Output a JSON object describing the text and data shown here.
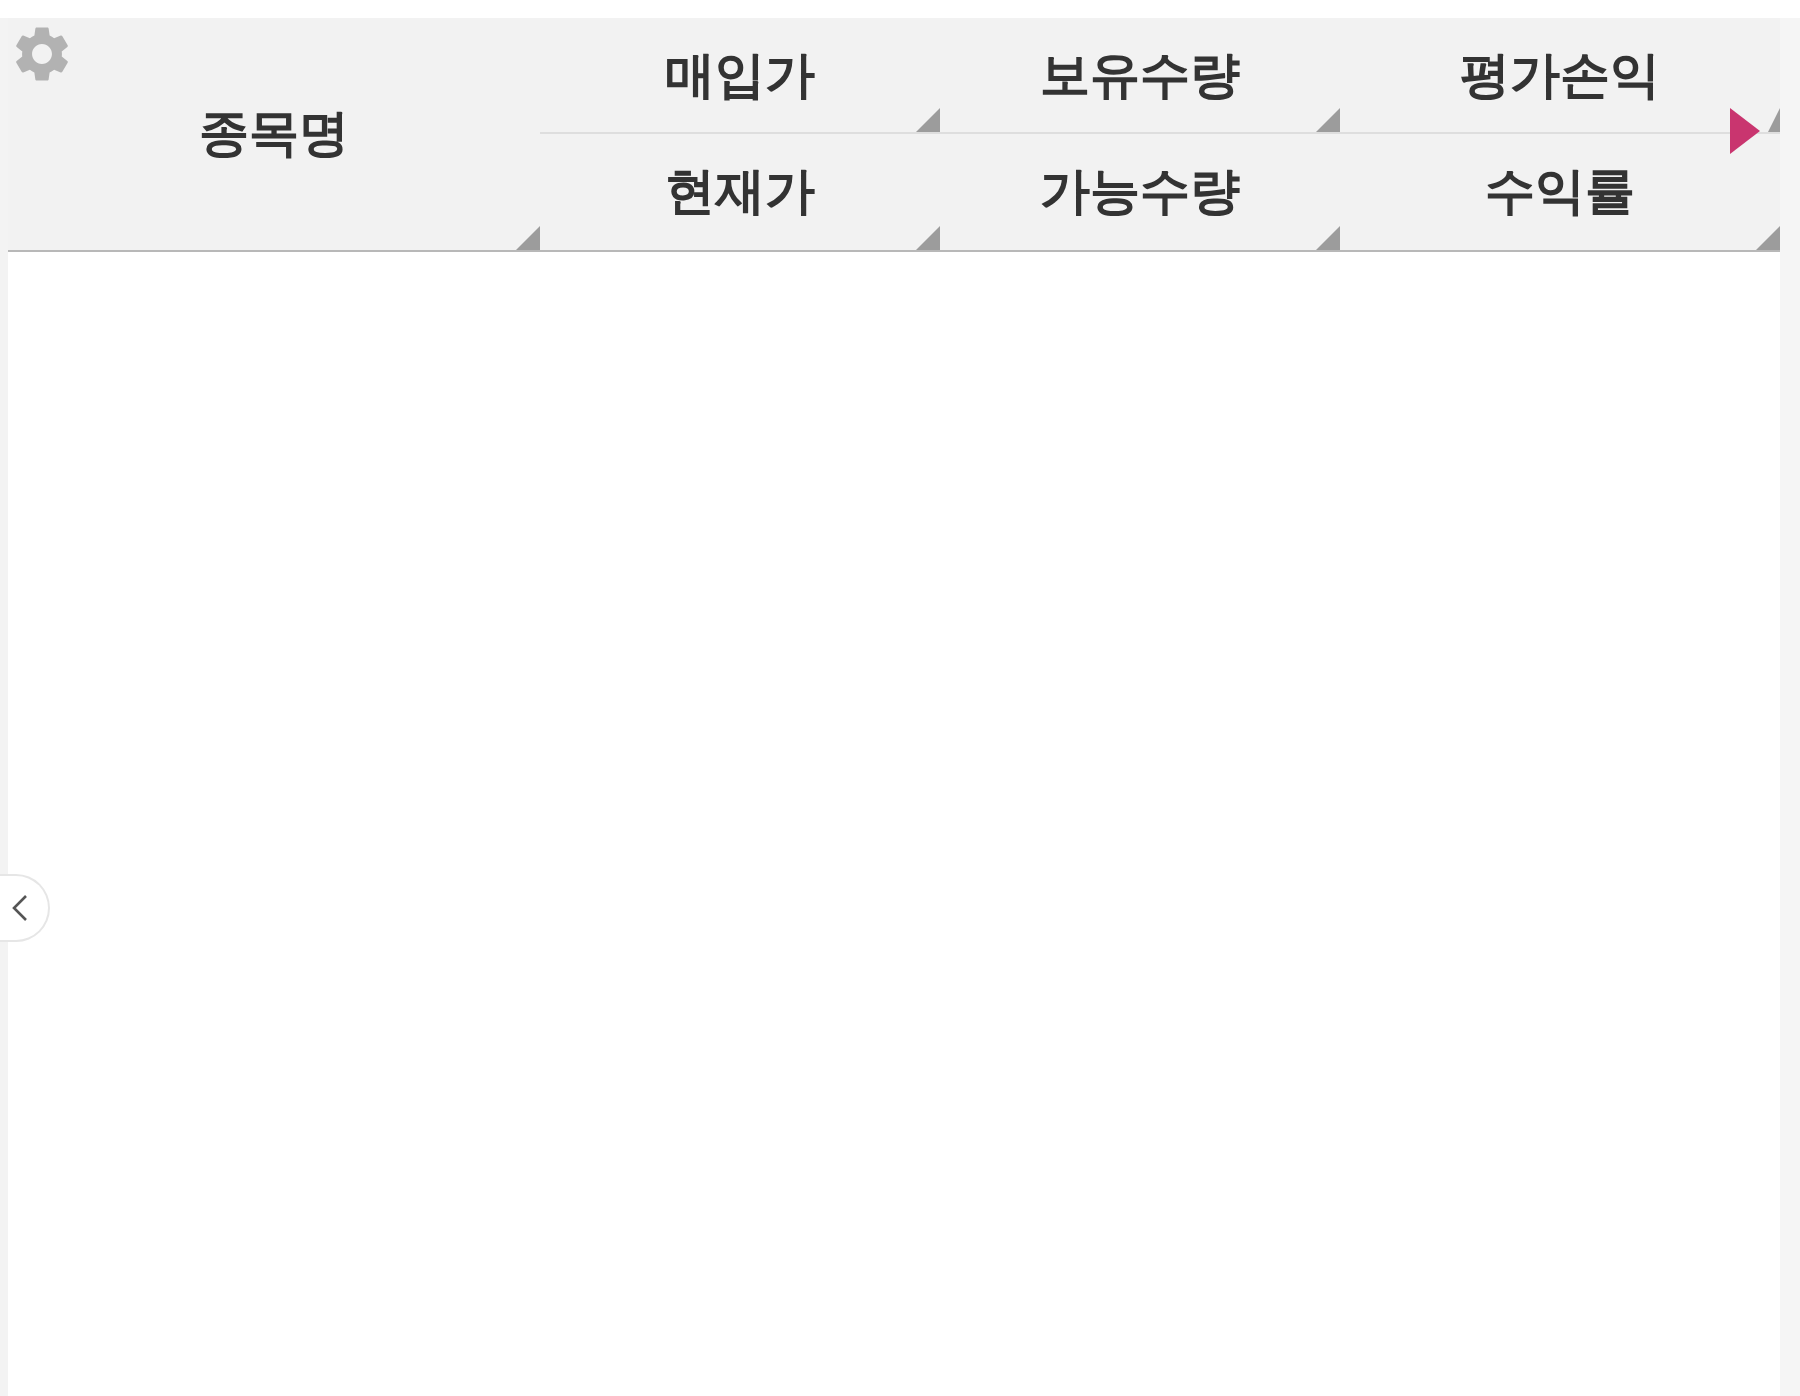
{
  "header": {
    "name_column": "종목명",
    "columns": [
      {
        "top": "매입가",
        "bottom": "현재가"
      },
      {
        "top": "보유수량",
        "bottom": "가능수량"
      },
      {
        "top": "평가손익",
        "bottom": "수익률"
      }
    ]
  }
}
